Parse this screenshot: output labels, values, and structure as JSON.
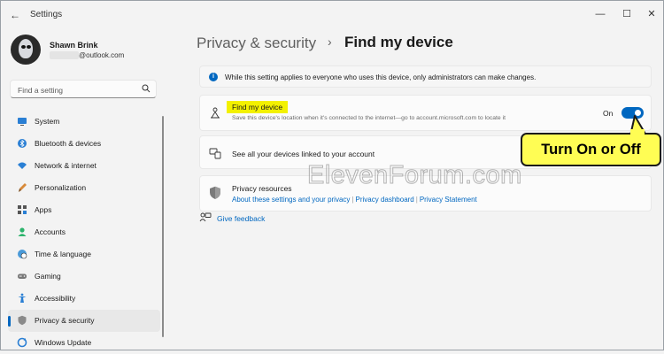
{
  "window": {
    "title": "Settings",
    "back_glyph": "←",
    "minimize_glyph": "—",
    "maximize_glyph": "☐",
    "close_glyph": "✕"
  },
  "profile": {
    "name": "Shawn Brink",
    "email": "@outlook.com"
  },
  "search": {
    "placeholder": "Find a setting",
    "icon": "search-icon"
  },
  "sidebar": {
    "items": [
      {
        "label": "System",
        "icon": "system-icon",
        "selected": false
      },
      {
        "label": "Bluetooth & devices",
        "icon": "bluetooth-icon",
        "selected": false
      },
      {
        "label": "Network & internet",
        "icon": "wifi-icon",
        "selected": false
      },
      {
        "label": "Personalization",
        "icon": "brush-icon",
        "selected": false
      },
      {
        "label": "Apps",
        "icon": "apps-icon",
        "selected": false
      },
      {
        "label": "Accounts",
        "icon": "accounts-icon",
        "selected": false
      },
      {
        "label": "Time & language",
        "icon": "globe-clock-icon",
        "selected": false
      },
      {
        "label": "Gaming",
        "icon": "gamepad-icon",
        "selected": false
      },
      {
        "label": "Accessibility",
        "icon": "accessibility-icon",
        "selected": false
      },
      {
        "label": "Privacy & security",
        "icon": "shield-icon",
        "selected": true
      },
      {
        "label": "Windows Update",
        "icon": "windows-update-icon",
        "selected": false
      }
    ]
  },
  "breadcrumb": {
    "parent": "Privacy & security",
    "separator": "›",
    "current": "Find my device"
  },
  "info_bar": {
    "glyph": "i",
    "text": "While this setting applies to everyone who uses this device, only administrators can make changes."
  },
  "find_my_device": {
    "title": "Find my device",
    "description": "Save this device's location when it's connected to the internet—go to account.microsoft.com to locate it",
    "toggle_label": "On",
    "toggle_on": true,
    "accent": "#0067c0"
  },
  "devices_link": {
    "text": "See all your devices linked to your account"
  },
  "privacy_resources": {
    "title": "Privacy resources",
    "links": [
      "About these settings and your privacy",
      "Privacy dashboard",
      "Privacy Statement"
    ],
    "separator": "|"
  },
  "feedback": {
    "label": "Give feedback"
  },
  "watermark": "ElevenForum.com",
  "callout": {
    "text": "Turn On or Off",
    "color": "#fffd54"
  }
}
